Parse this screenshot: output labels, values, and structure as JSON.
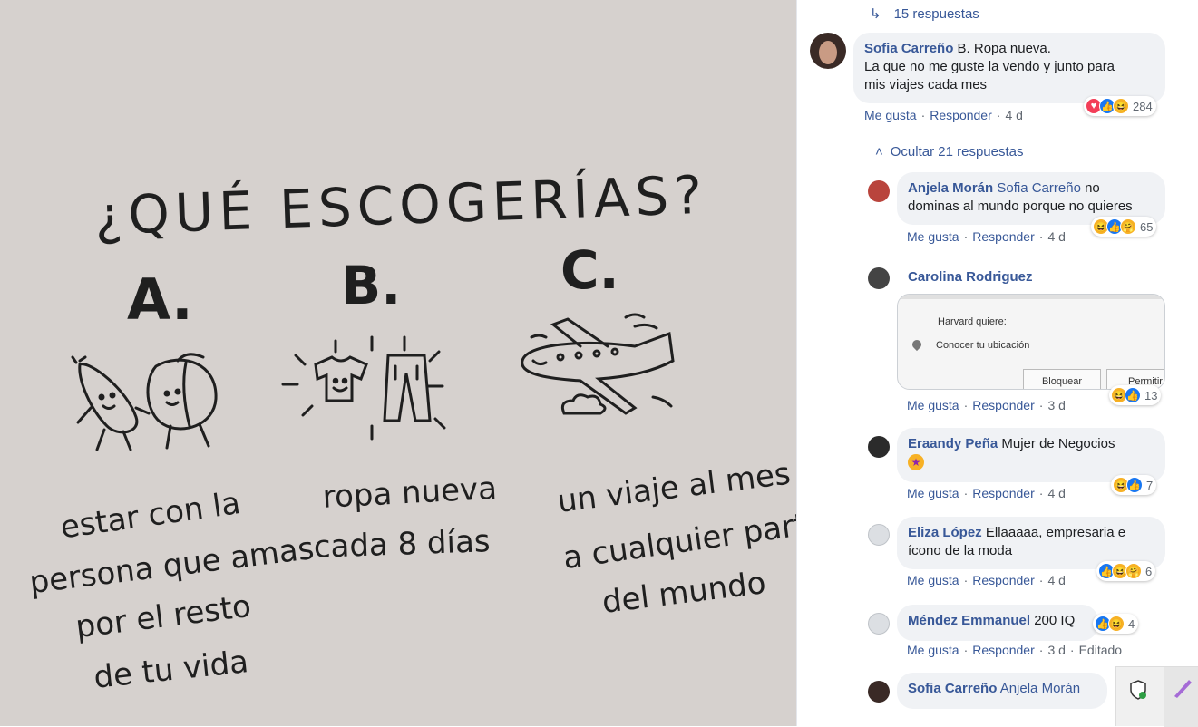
{
  "image": {
    "title": "¿QUÉ ESCOGERÍAS?",
    "options": [
      {
        "letter": "A.",
        "line1": "estar con la",
        "line2": "persona que amas",
        "line3": "por el resto",
        "line4": "de tu vida"
      },
      {
        "letter": "B.",
        "line1": "ropa nueva",
        "line2": "cada 8 días"
      },
      {
        "letter": "C.",
        "line1": "un viaje al mes",
        "line2": "a cualquier parte",
        "line3": "del mundo"
      }
    ]
  },
  "comments_panel": {
    "replies_link": "15 respuestas",
    "hide_replies": "Ocultar 21 respuestas",
    "actions": {
      "like": "Me gusta",
      "reply": "Responder",
      "edited": "Editado"
    },
    "main_comment": {
      "author": "Sofia Carreño",
      "text_line1": "B. Ropa nueva.",
      "text_line2": "La que no me guste la vendo y junto para",
      "text_line3": "mis viajes cada mes",
      "time": "4 d",
      "reaction_count": "284",
      "reactions": [
        "love",
        "like",
        "haha"
      ]
    },
    "replies": [
      {
        "author": "Anjela Morán",
        "mention": "Sofia Carreño",
        "text_a": "no",
        "text_b": "dominas al mundo porque no quieres",
        "time": "4 d",
        "reaction_count": "65",
        "reactions": [
          "haha",
          "like",
          "care"
        ]
      },
      {
        "author": "Carolina Rodriguez",
        "attachment": {
          "heading": "Harvard quiere:",
          "item": "Conocer tu ubicación",
          "block_button": "Bloquear",
          "allow_button": "Permitir"
        },
        "time": "3 d",
        "reaction_count": "13",
        "reactions": [
          "haha",
          "like"
        ]
      },
      {
        "author": "Eraandy Peña",
        "text": "Mujer de Negocios",
        "emoji": "star-struck",
        "time": "4 d",
        "reaction_count": "7",
        "reactions": [
          "haha",
          "like"
        ]
      },
      {
        "author": "Eliza López",
        "text_a": "Ellaaaaa, empresaria e",
        "text_b": "ícono de la moda",
        "time": "4 d",
        "reaction_count": "6",
        "reactions": [
          "like",
          "haha",
          "care"
        ]
      },
      {
        "author": "Méndez Emmanuel",
        "text": "200 IQ",
        "time": "3 d",
        "reaction_count": "4",
        "reactions": [
          "like",
          "haha"
        ]
      },
      {
        "author": "Sofia Carreño",
        "mention": "Anjela Morán"
      }
    ]
  },
  "colors": {
    "link": "#385898",
    "bubble": "#f0f2f5",
    "photo_bg": "#d6d1ce",
    "meta": "#606770"
  }
}
